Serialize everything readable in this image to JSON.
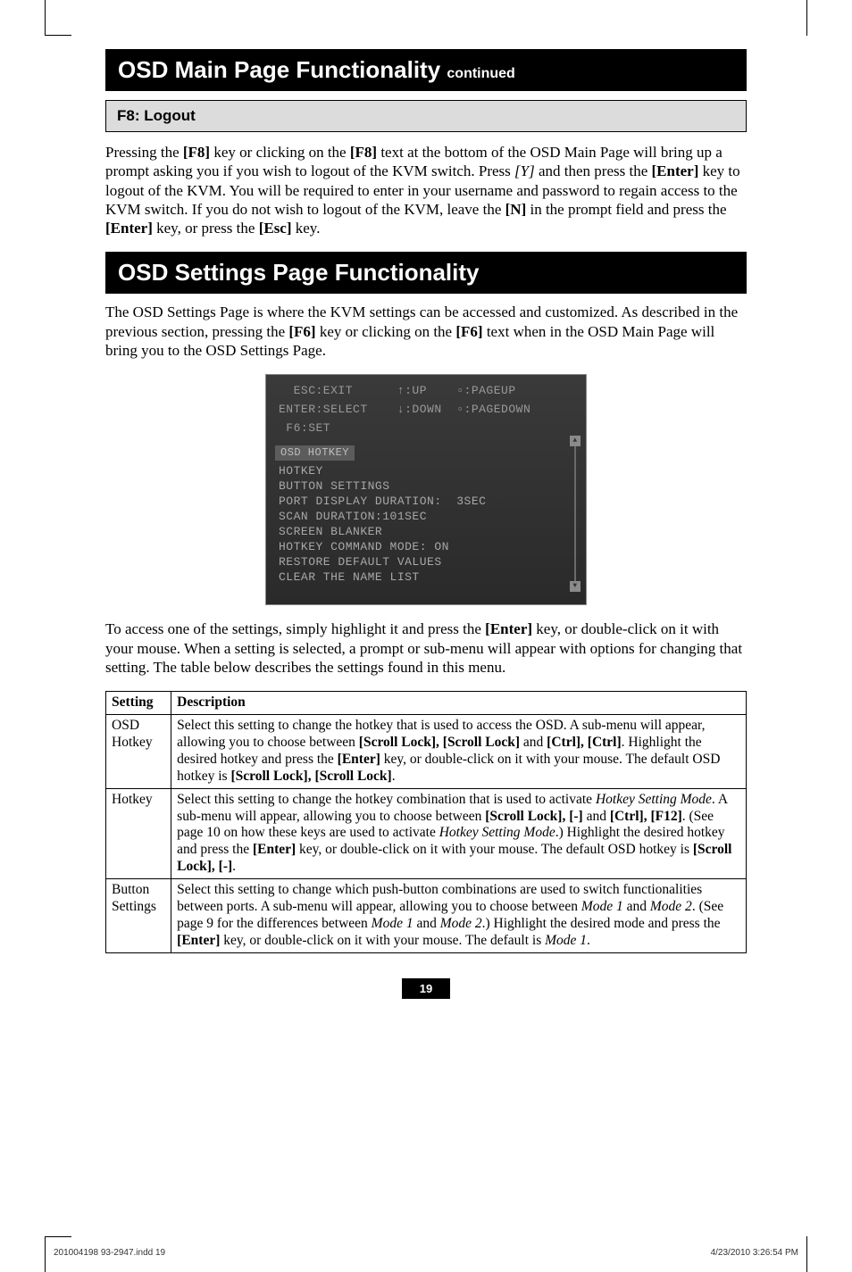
{
  "header1": {
    "title": "OSD Main Page Functionality",
    "suffix": "continued"
  },
  "sub1": {
    "title": "F8: Logout"
  },
  "para1": "Pressing the [F8] key or clicking on the [F8] text at the bottom of the OSD Main Page will bring up a prompt asking you if you wish to logout of the KVM switch. Press [Y] and then press the [Enter] key to logout of the KVM. You will be required to enter in your username and password to regain access to the KVM switch. If you do not wish to logout of the KVM, leave the [N] in the prompt field and press the [Enter] key, or press the [Esc] key.",
  "header2": {
    "title": "OSD Settings Page Functionality"
  },
  "para2": "The OSD Settings Page is where the KVM settings can be accessed and customized. As described in the previous section, pressing the [F6] key or clicking on the [F6] text when in the OSD Main Page will bring you to the OSD Settings Page.",
  "screenshot": {
    "hdr1": "  ESC:EXIT      ↑:UP    ▫:PAGEUP",
    "hdr2": "ENTER:SELECT    ↓:DOWN  ▫:PAGEDOWN",
    "hdr3": " F6:SET",
    "highlight": "OSD HOTKEY",
    "lines": [
      "HOTKEY",
      "BUTTON SETTINGS",
      "PORT DISPLAY DURATION:  3SEC",
      "SCAN DURATION:101SEC",
      "SCREEN BLANKER",
      "HOTKEY COMMAND MODE: ON",
      "RESTORE DEFAULT VALUES",
      "CLEAR THE NAME LIST"
    ]
  },
  "para3": "To access one of the settings, simply highlight it and press the [Enter] key, or double-click on it with your mouse. When a setting is selected, a prompt or sub-menu will appear with options for changing that setting. The table below describes the settings found in this menu.",
  "table": {
    "head": [
      "Setting",
      "Description"
    ],
    "rows": [
      {
        "setting": "OSD Hotkey",
        "desc": "Select this setting to change the hotkey that is used to access the OSD. A sub-menu will appear, allowing you to choose between [Scroll Lock], [Scroll Lock] and [Ctrl], [Ctrl]. Highlight the desired hotkey and press the [Enter] key, or double-click on it with your mouse. The default OSD hotkey is [Scroll Lock], [Scroll Lock]."
      },
      {
        "setting": "Hotkey",
        "desc": "Select this setting to change the hotkey combination that is used to activate Hotkey Setting Mode. A sub-menu will appear, allowing you to choose between [Scroll Lock], [-] and [Ctrl], [F12]. (See page 10 on how these keys are used to activate Hotkey Setting Mode.) Highlight the desired hotkey and press the [Enter] key, or double-click on it with your mouse. The default OSD hotkey is [Scroll Lock], [-]."
      },
      {
        "setting": "Button Settings",
        "desc": "Select this setting to change which push-button combinations are used to switch functionalities between ports. A sub-menu will appear, allowing you to choose between Mode 1 and Mode 2. (See page 9 for the differences between Mode 1 and Mode 2.) Highlight the desired mode and press the [Enter] key, or double-click on it with your mouse. The default is Mode 1."
      }
    ]
  },
  "page_number": "19",
  "footer": {
    "left": "201004198  93-2947.indd   19",
    "right": "4/23/2010   3:26:54 PM"
  }
}
